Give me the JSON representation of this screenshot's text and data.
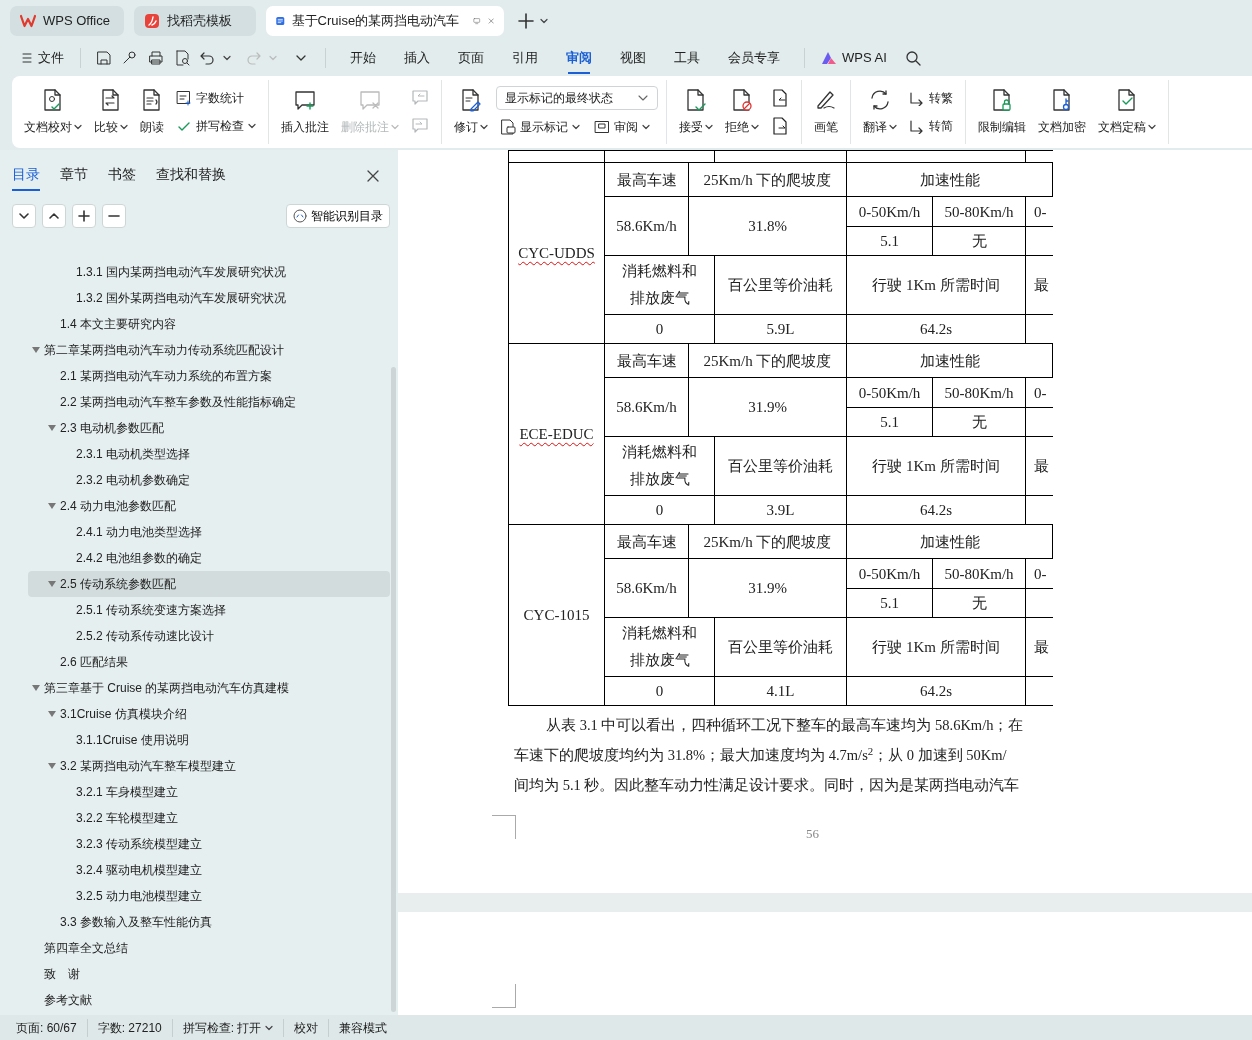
{
  "browser_tabs": [
    {
      "label": "WPS Office",
      "selected": false
    },
    {
      "label": "找稻壳模板",
      "selected": false
    },
    {
      "label": "基于Cruise的某两挡电动汽车",
      "selected": true
    }
  ],
  "menu": {
    "file": "文件",
    "tabs": [
      {
        "label": "开始",
        "selected": false
      },
      {
        "label": "插入",
        "selected": false
      },
      {
        "label": "页面",
        "selected": false
      },
      {
        "label": "引用",
        "selected": false
      },
      {
        "label": "审阅",
        "selected": true
      },
      {
        "label": "视图",
        "selected": false
      },
      {
        "label": "工具",
        "selected": false
      },
      {
        "label": "会员专享",
        "selected": false
      }
    ],
    "ai": "WPS AI"
  },
  "ribbon": {
    "groups": [
      {
        "columns": [
          {
            "kind": "large",
            "label": "文档校对",
            "dropdown": true,
            "disabled": false
          },
          {
            "kind": "large",
            "label": "比较",
            "dropdown": true,
            "disabled": false
          },
          {
            "kind": "large",
            "label": "朗读",
            "dropdown": false,
            "disabled": false
          },
          {
            "kind": "stack",
            "items": [
              {
                "label": "字数统计",
                "dropdown": false,
                "disabled": false
              },
              {
                "label": "拼写检查",
                "dropdown": true,
                "disabled": false
              }
            ]
          }
        ]
      },
      {
        "columns": [
          {
            "kind": "large",
            "label": "插入批注",
            "dropdown": false,
            "disabled": false
          },
          {
            "kind": "large",
            "label": "删除批注",
            "dropdown": true,
            "disabled": true
          },
          {
            "kind": "stack",
            "items": [
              {
                "dropdown": false,
                "disabled": true
              },
              {
                "dropdown": false,
                "disabled": true
              }
            ]
          }
        ]
      },
      {
        "columns": [
          {
            "kind": "large",
            "label": "修订",
            "dropdown": true,
            "disabled": false
          },
          {
            "kind": "select",
            "value": "显示标记的最终状态",
            "items": [
              {
                "label": "显示标记",
                "dropdown": true,
                "disabled": false
              },
              {
                "label": "审阅",
                "dropdown": true,
                "disabled": false
              }
            ]
          }
        ]
      },
      {
        "columns": [
          {
            "kind": "large",
            "label": "接受",
            "dropdown": true,
            "disabled": false
          },
          {
            "kind": "large",
            "label": "拒绝",
            "dropdown": true,
            "disabled": false
          },
          {
            "kind": "stack",
            "items": [
              {
                "dropdown": false,
                "disabled": false
              },
              {
                "dropdown": false,
                "disabled": false
              }
            ]
          }
        ]
      },
      {
        "columns": [
          {
            "kind": "large",
            "label": "画笔",
            "dropdown": false,
            "disabled": false
          }
        ]
      },
      {
        "columns": [
          {
            "kind": "large",
            "label": "翻译",
            "dropdown": true,
            "disabled": false
          },
          {
            "kind": "stack",
            "items": [
              {
                "label": "转繁",
                "dropdown": false,
                "disabled": false
              },
              {
                "label": "转简",
                "dropdown": false,
                "disabled": false
              }
            ]
          }
        ]
      },
      {
        "columns": [
          {
            "kind": "large",
            "label": "限制编辑",
            "dropdown": false,
            "disabled": false
          },
          {
            "kind": "large",
            "label": "文档加密",
            "dropdown": false,
            "disabled": false
          },
          {
            "kind": "large",
            "label": "文档定稿",
            "dropdown": true,
            "disabled": false
          }
        ]
      }
    ]
  },
  "nav_panel": {
    "tabs": [
      {
        "label": "目录",
        "selected": true
      },
      {
        "label": "章节",
        "selected": false
      },
      {
        "label": "书签",
        "selected": false
      },
      {
        "label": "查找和替换",
        "selected": false
      }
    ],
    "smart_button": "智能识别目录",
    "toc": [
      {
        "children": [
          {
            "children": [
              {
                "label": "1.3.1 国内某两挡电动汽车发展研究状况",
                "selected": false
              },
              {
                "label": "1.3.2 国外某两挡电动汽车发展研究状况",
                "selected": false
              }
            ]
          },
          {
            "label": "1.4 本文主要研究内容",
            "selected": false
          }
        ]
      },
      {
        "label": "第二章某两挡电动汽车动力传动系统匹配设计",
        "selected": false,
        "expanded": true,
        "children": [
          {
            "label": "2.1 某两挡电动汽车动力系统的布置方案",
            "selected": false
          },
          {
            "label": "2.2 某两挡电动汽车整车参数及性能指标确定",
            "selected": false
          },
          {
            "label": "2.3 电动机参数匹配",
            "selected": false,
            "expanded": true,
            "children": [
              {
                "label": "2.3.1 电动机类型选择",
                "selected": false
              },
              {
                "label": "2.3.2 电动机参数确定",
                "selected": false
              }
            ]
          },
          {
            "label": "2.4 动力电池参数匹配",
            "selected": false,
            "expanded": true,
            "children": [
              {
                "label": "2.4.1 动力电池类型选择",
                "selected": false
              },
              {
                "label": "2.4.2 电池组参数的确定",
                "selected": false
              }
            ]
          },
          {
            "label": "2.5 传动系统参数匹配",
            "selected": true,
            "expanded": true,
            "children": [
              {
                "label": "2.5.1 传动系统变速方案选择",
                "selected": false
              },
              {
                "label": "2.5.2 传动系传动速比设计",
                "selected": false
              }
            ]
          },
          {
            "label": "2.6 匹配结果",
            "selected": false
          }
        ]
      },
      {
        "label": "第三章基于 Cruise 的某两挡电动汽车仿真建模",
        "selected": false,
        "expanded": true,
        "children": [
          {
            "label": "3.1Cruise 仿真模块介绍",
            "selected": false,
            "expanded": true,
            "children": [
              {
                "label": "3.1.1Cruise 使用说明",
                "selected": false
              }
            ]
          },
          {
            "label": "3.2 某两挡电动汽车整车模型建立",
            "selected": false,
            "expanded": true,
            "children": [
              {
                "label": "3.2.1 车身模型建立",
                "selected": false
              },
              {
                "label": "3.2.2 车轮模型建立",
                "selected": false
              },
              {
                "label": "3.2.3 传动系统模型建立",
                "selected": false
              },
              {
                "label": "3.2.4 驱动电机模型建立",
                "selected": false
              },
              {
                "label": "3.2.5 动力电池模型建立",
                "selected": false
              }
            ]
          },
          {
            "label": "3.3 参数输入及整车性能仿真",
            "selected": false
          }
        ]
      },
      {
        "label": "第四章全文总结",
        "selected": false
      },
      {
        "label": "致　谢",
        "selected": false
      },
      {
        "label": "参考文献",
        "selected": false
      }
    ]
  },
  "table": {
    "groups": [
      {
        "name": "CYC-UDDS",
        "spell_error": true,
        "speed_label": "最高车速",
        "grade_label": "25Km/h 下的爬坡度",
        "accel_label": "加速性能",
        "speed": "58.6Km/h",
        "grade": "31.8%",
        "accel_headers": [
          "0-50Km/h",
          "50-80Km/h",
          "0-"
        ],
        "accel_values": [
          "5.1",
          "无"
        ],
        "fuel_labels": [
          "消耗燃料和排放废气",
          "百公里等价油耗",
          "行驶 1Km 所需时间",
          "最"
        ],
        "fuel_values": [
          "0",
          "5.9L",
          "64.2s"
        ]
      },
      {
        "name": "ECE-EDUC",
        "spell_error": true,
        "speed_label": "最高车速",
        "grade_label": "25Km/h 下的爬坡度",
        "accel_label": "加速性能",
        "speed": "58.6Km/h",
        "grade": "31.9%",
        "accel_headers": [
          "0-50Km/h",
          "50-80Km/h",
          "0-"
        ],
        "accel_values": [
          "5.1",
          "无"
        ],
        "fuel_labels": [
          "消耗燃料和排放废气",
          "百公里等价油耗",
          "行驶 1Km 所需时间",
          "最"
        ],
        "fuel_values": [
          "0",
          "3.9L",
          "64.2s"
        ]
      },
      {
        "name": "CYC-1015",
        "spell_error": false,
        "speed_label": "最高车速",
        "grade_label": "25Km/h 下的爬坡度",
        "accel_label": "加速性能",
        "speed": "58.6Km/h",
        "grade": "31.9%",
        "accel_headers": [
          "0-50Km/h",
          "50-80Km/h",
          "0-"
        ],
        "accel_values": [
          "5.1",
          "无"
        ],
        "fuel_labels": [
          "消耗燃料和排放废气",
          "百公里等价油耗",
          "行驶 1Km 所需时间",
          "最"
        ],
        "fuel_values": [
          "0",
          "4.1L",
          "64.2s"
        ]
      }
    ]
  },
  "paragraph": [
    "从表 3.1 中可以看出，四种循环工况下整车的最高车速均为 58.6Km/h；在",
    "车速下的爬坡度均约为 31.8%；最大加速度均为 4.7m/s$^{2}$；从 0 加速到 50Km/",
    "间均为 5.1 秒。因此整车动力性满足设计要求。同时，因为是某两挡电动汽车"
  ],
  "page_number": "56",
  "status_bar": [
    {
      "kind": "text",
      "label": "页面: 60/67"
    },
    {
      "kind": "text",
      "label": "字数: 27210"
    },
    {
      "kind": "dropdown",
      "label": "拼写检查: 打开"
    },
    {
      "kind": "text",
      "label": "校对"
    },
    {
      "kind": "text",
      "label": "兼容模式"
    }
  ]
}
